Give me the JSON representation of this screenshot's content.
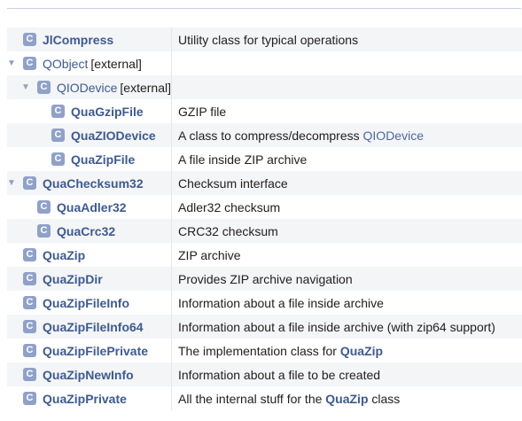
{
  "classes": {
    "r0": {
      "name": "JlCompress",
      "desc": "Utility class for typical operations"
    },
    "r1": {
      "name": "QObject",
      "ext": "[external]"
    },
    "r2": {
      "name": "QIODevice",
      "ext": "[external]"
    },
    "r3": {
      "name": "QuaGzipFile",
      "desc": "GZIP file"
    },
    "r4": {
      "name": "QuaZIODevice",
      "desc_pre": "A class to compress/decompress ",
      "desc_link": "QIODevice"
    },
    "r5": {
      "name": "QuaZipFile",
      "desc": "A file inside ZIP archive"
    },
    "r6": {
      "name": "QuaChecksum32",
      "desc": "Checksum interface"
    },
    "r7": {
      "name": "QuaAdler32",
      "desc": "Adler32 checksum"
    },
    "r8": {
      "name": "QuaCrc32",
      "desc": "CRC32 checksum"
    },
    "r9": {
      "name": "QuaZip",
      "desc": "ZIP archive"
    },
    "r10": {
      "name": "QuaZipDir",
      "desc": "Provides ZIP archive navigation"
    },
    "r11": {
      "name": "QuaZipFileInfo",
      "desc": "Information about a file inside archive"
    },
    "r12": {
      "name": "QuaZipFileInfo64",
      "desc": "Information about a file inside archive (with zip64 support)"
    },
    "r13": {
      "name": "QuaZipFilePrivate",
      "desc_pre": "The implementation class for ",
      "desc_link": "QuaZip"
    },
    "r14": {
      "name": "QuaZipNewInfo",
      "desc": "Information about a file to be created"
    },
    "r15": {
      "name": "QuaZipPrivate",
      "desc_pre": "All the internal stuff for the ",
      "desc_link": "QuaZip",
      "desc_post": " class"
    }
  },
  "icon_letter": "C",
  "expand_arrow": "▼",
  "colors": {
    "link": "#3c5a93",
    "icon_bg": "#8fa1c9",
    "row_alt": "#f4f5f7",
    "arrow": "#8aa2c4"
  }
}
